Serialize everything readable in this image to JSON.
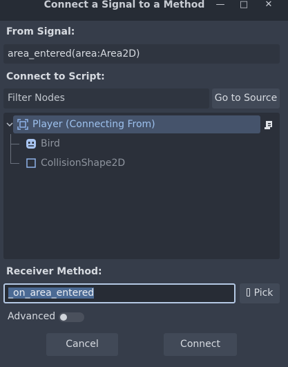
{
  "window": {
    "title": "Connect a Signal to a Method",
    "minimize": "—",
    "maximize": "□",
    "close": "✕"
  },
  "from_signal": {
    "label": "From Signal:",
    "value": "area_entered(area:Area2D)"
  },
  "connect_to_script": {
    "label": "Connect to Script:",
    "filter_placeholder": "Filter Nodes",
    "go_to_source": "Go to Source"
  },
  "tree": {
    "items": [
      {
        "label": "Player (Connecting From)",
        "icon": "area2d-icon",
        "selected": true
      },
      {
        "label": "Bird",
        "icon": "sprite-icon",
        "selected": false
      },
      {
        "label": "CollisionShape2D",
        "icon": "collisionshape-icon",
        "selected": false
      }
    ],
    "script_icon": "script-icon"
  },
  "receiver": {
    "label": "Receiver Method:",
    "value": "_on_area_entered",
    "pick_label": "Pick"
  },
  "advanced": {
    "label": "Advanced",
    "enabled": false
  },
  "buttons": {
    "cancel": "Cancel",
    "connect": "Connect"
  },
  "colors": {
    "background": "#363d4a",
    "tree_bg": "#2b303a",
    "selection": "#45536b",
    "accent_text": "#9dc1ee",
    "input_focus": "#b5c9e4"
  }
}
